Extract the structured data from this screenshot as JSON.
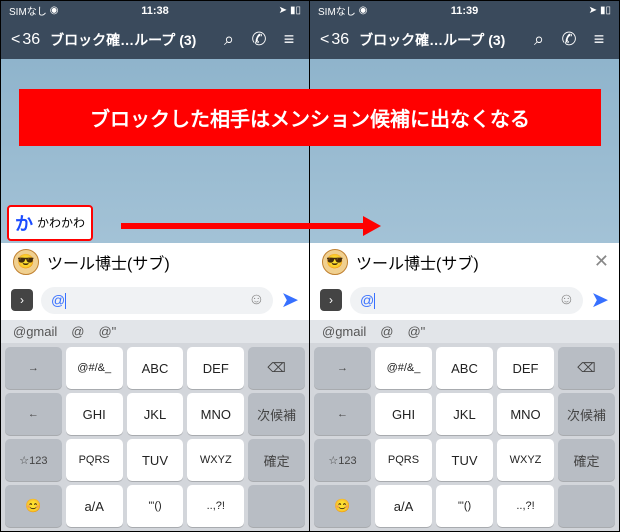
{
  "annotation": "ブロックした相手はメンション候補に出なくなる",
  "status": {
    "carrier": "SIMなし",
    "wifi_icon": "wifi-icon",
    "time_left": "11:38",
    "time_right": "11:39",
    "gps_icon": "location-icon",
    "battery_icon": "battery-icon"
  },
  "header": {
    "back_count": "36",
    "title": "ブロック確…ループ (3)",
    "icons": [
      "search-icon",
      "call-icon",
      "menu-icon"
    ]
  },
  "mention_candidate": {
    "avatar_letter": "か",
    "name": "かわかわ"
  },
  "mention_list": {
    "name": "ツール博士(サブ)"
  },
  "input": {
    "value": "@"
  },
  "predictions": [
    "@gmail",
    "@",
    "@\""
  ],
  "keyboard": {
    "rows": [
      [
        "→",
        "@#/&_",
        "ABC",
        "DEF",
        "⌫"
      ],
      [
        "←",
        "GHI",
        "JKL",
        "MNO",
        "次候補"
      ],
      [
        "☆123",
        "PQRS",
        "TUV",
        "WXYZ",
        "確定"
      ],
      [
        "😊",
        "a/A",
        "'\"()",
        "..,?!",
        ""
      ]
    ],
    "gray_keys": [
      "→",
      "←",
      "☆123",
      "😊",
      "⌫",
      "次候補",
      "確定",
      ""
    ]
  }
}
